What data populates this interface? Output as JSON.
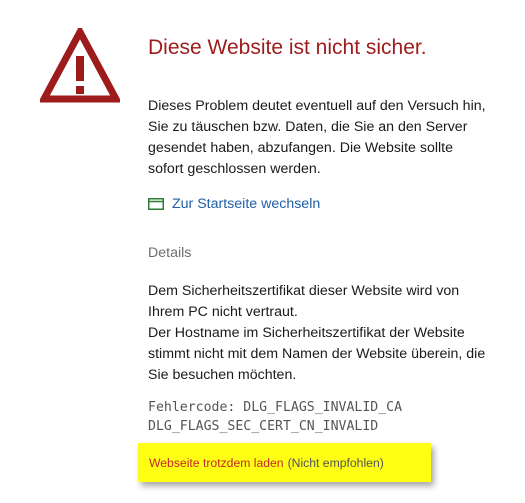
{
  "page": {
    "title": "Diese Website ist nicht sicher.",
    "intro": "Dieses Problem deutet eventuell auf den Versuch hin, Sie zu täuschen bzw. Daten, die Sie an den Server gesendet haben, abzufangen. Die Website sollte sofort geschlossen werden.",
    "home_link_label": "Zur Startseite wechseln",
    "details_heading": "Details",
    "details_line_1": "Dem Sicherheitszertifikat dieser Website wird von Ihrem PC nicht vertraut.",
    "details_line_2": "Der Hostname im Sicherheitszertifikat der Website stimmt nicht mit dem Namen der Website überein, die Sie besuchen möchten.",
    "error_code_1": "Fehlercode: DLG_FLAGS_INVALID_CA",
    "error_code_2": "DLG_FLAGS_SEC_CERT_CN_INVALID",
    "load_anyway_label": "Webseite trotzdem laden",
    "load_anyway_note": "(Nicht empfohlen)"
  },
  "icons": {
    "warning": "warning-triangle-icon",
    "home_link": "window-icon"
  },
  "colors": {
    "warning_red": "#9e1b1b",
    "link_blue": "#1f5fa8",
    "highlight_yellow": "#ffff14",
    "load_anyway_red": "#c62828"
  }
}
